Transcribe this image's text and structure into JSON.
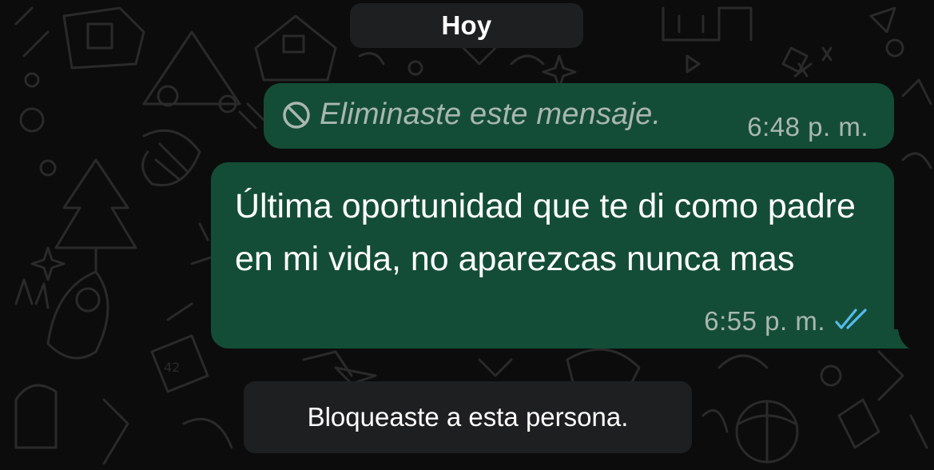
{
  "date_separator": "Hoy",
  "messages": [
    {
      "type": "deleted",
      "text": "Eliminaste este mensaje.",
      "time": "6:48 p. m.",
      "icon": "ban-icon"
    },
    {
      "type": "outgoing",
      "text": "Última oportunidad que te di como padre en mi vida, no aparezcas nunca mas",
      "time": "6:55 p. m.",
      "status_icon": "double-check-read-icon"
    }
  ],
  "system_notice": "Bloqueaste a esta persona.",
  "colors": {
    "background": "#0c0c0c",
    "bubble_outgoing": "#144d37",
    "pill": "#1e1f20",
    "read_check": "#53bdeb",
    "muted_text": "#a9b7af"
  }
}
